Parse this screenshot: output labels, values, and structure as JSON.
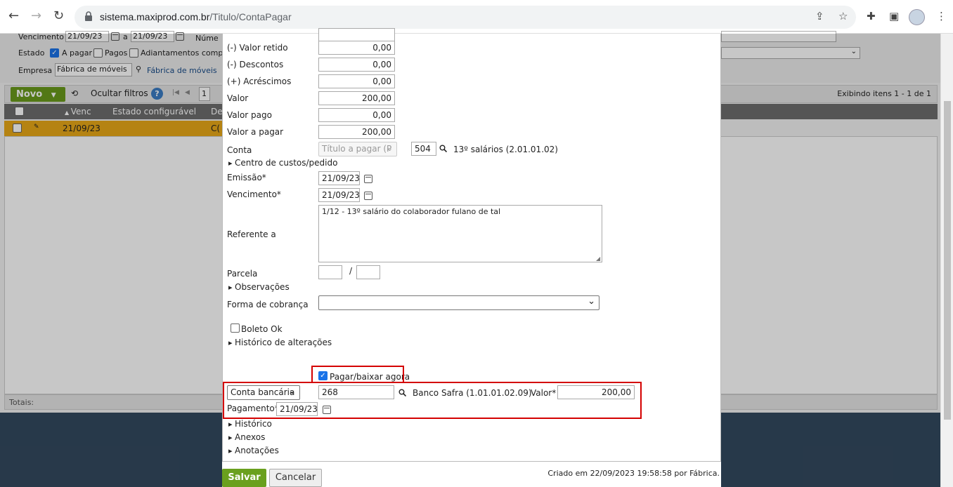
{
  "browser": {
    "url_host": "sistema.maxiprod.com.br",
    "url_path": "/Titulo/ContaPagar"
  },
  "bg": {
    "vencimento_label": "Vencimento",
    "venc_from": "21/09/23",
    "venc_a": "a",
    "venc_to": "21/09/23",
    "numero_label": "Núme",
    "estado_label": "Estado",
    "a_pagar": "A pagar",
    "pagos": "Pagos",
    "adiantamentos": "Adiantamentos comp",
    "empresa_label": "Empresa",
    "empresa_value": "Fábrica de móveis",
    "empresa_lookup": "Fábrica de móveis",
    "novo": "Novo",
    "ocultar_filtros": "Ocultar filtros",
    "page": "1",
    "exibindo": "Exibindo itens 1 - 1 de 1",
    "col_venc": "Venc",
    "col_estado": "Estado configurável",
    "col_de": "De",
    "row_venc": "21/09/23",
    "row_de": "C(",
    "totais": "Totais:"
  },
  "form": {
    "valor_retido_label": "(-) Valor retido",
    "valor_retido": "0,00",
    "descontos_label": "(-) Descontos",
    "descontos": "0,00",
    "acrescimos_label": "(+) Acréscimos",
    "acrescimos": "0,00",
    "valor_label": "Valor",
    "valor": "200,00",
    "valor_pago_label": "Valor pago",
    "valor_pago": "0,00",
    "valor_a_pagar_label": "Valor a pagar",
    "valor_a_pagar": "200,00",
    "conta_label": "Conta",
    "conta_tipo": "Título a pagar (P",
    "conta_codigo": "504",
    "conta_desc": "13º salários (2.01.01.02)",
    "centro_custos": "Centro de custos/pedido",
    "emissao_label": "Emissão*",
    "emissao": "21/09/23",
    "vencimento_label": "Vencimento*",
    "vencimento": "21/09/23",
    "referente_label": "Referente a",
    "referente": "1/12 - 13º salário do colaborador fulano de tal",
    "parcela_label": "Parcela",
    "parcela_sep": "/",
    "observacoes": "Observações",
    "forma_cobranca_label": "Forma de cobrança",
    "boleto_ok": "Boleto Ok",
    "historico_alteracoes": "Histórico de alterações",
    "pagar_baixar": "Pagar/baixar agora",
    "conta_bancaria": "Conta bancária",
    "banco_codigo": "268",
    "banco_desc": "Banco Safra (1.01.01.02.09)",
    "valor_star_label": "Valor*",
    "valor_pagamento": "200,00",
    "pagamento_label": "Pagamento*",
    "pagamento": "21/09/23",
    "historico": "Histórico",
    "anexos": "Anexos",
    "anotacoes": "Anotações"
  },
  "footer": {
    "salvar": "Salvar",
    "cancelar": "Cancelar",
    "criado": "Criado em 22/09/2023 19:58:58 por Fábrica."
  },
  "colors": {
    "accent_green": "#6aa01e",
    "highlight_red": "#d40000",
    "row_orange": "#e8a818"
  }
}
